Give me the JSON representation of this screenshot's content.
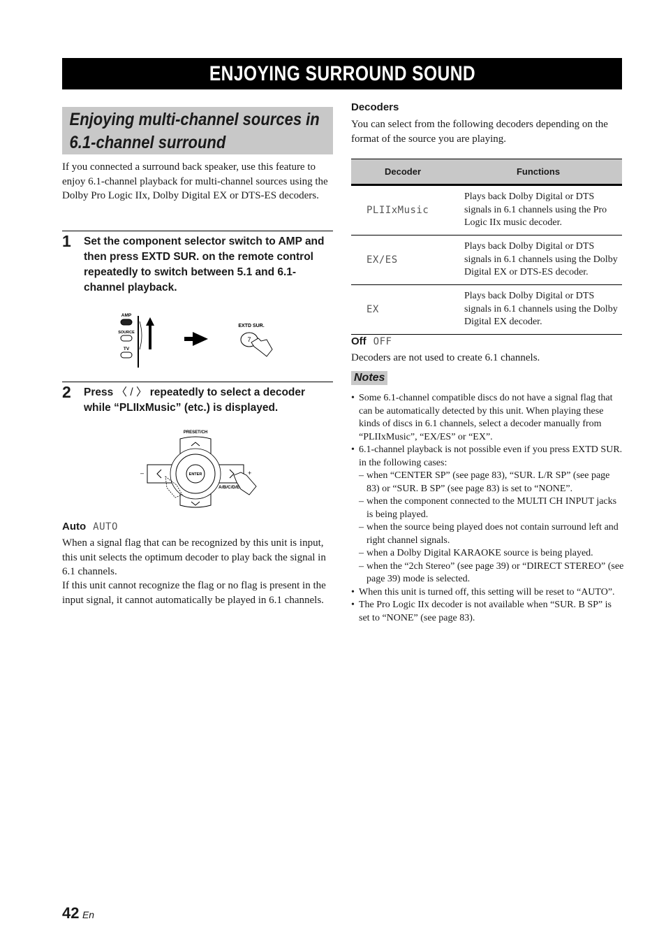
{
  "banner": {
    "title": "ENJOYING SURROUND SOUND"
  },
  "section": {
    "title_line1": "Enjoying multi-channel sources in",
    "title_line2": "6.1-channel surround",
    "intro": "If you connected a surround back speaker, use this feature to enjoy 6.1-channel playback for multi-channel sources using the Dolby Pro Logic IIx, Dolby Digital EX or DTS-ES decoders."
  },
  "steps": [
    {
      "number": "1",
      "text": "Set the component selector switch to AMP and then press EXTD SUR. on the remote control repeatedly to switch between 5.1 and 6.1-channel playback.",
      "illustration": {
        "switch_labels": [
          "AMP",
          "SOURCE",
          "TV"
        ],
        "button_label": "EXTD SUR.",
        "button_digit": "7"
      }
    },
    {
      "number": "2",
      "text_before": "Press ",
      "text_keys": "〈 / 〉",
      "text_after": " repeatedly to select a decoder while “PLIIxMusic” (etc.) is displayed.",
      "illustration": {
        "top_label": "PRESET/CH",
        "center_label": "ENTER",
        "right_label": "A/B/C/D/E",
        "minus": "–",
        "plus": "+"
      }
    }
  ],
  "auto": {
    "label": "Auto",
    "lcd": "AUTO",
    "para1": "When a signal flag that can be recognized by this unit is input, this unit selects the optimum decoder to play back the signal in 6.1 channels.",
    "para2": "If this unit cannot recognize the flag or no flag is present in the input signal, it cannot automatically be played in 6.1 channels."
  },
  "decoders": {
    "heading": "Decoders",
    "intro": "You can select from the following decoders depending on the format of the source you are playing.",
    "table": {
      "headers": [
        "Decoder",
        "Functions"
      ],
      "rows": [
        {
          "decoder": "PLIIxMusic",
          "function": "Plays back Dolby Digital or DTS signals in 6.1 channels using the Pro Logic IIx music decoder."
        },
        {
          "decoder": "EX/ES",
          "function": "Plays back Dolby Digital or DTS signals in 6.1 channels using the Dolby Digital EX or DTS-ES decoder."
        },
        {
          "decoder": "EX",
          "function": "Plays back Dolby Digital or DTS signals in 6.1 channels using the Dolby Digital EX decoder."
        }
      ]
    }
  },
  "off": {
    "label": "Off",
    "lcd": "OFF",
    "text": "Decoders are not used to create 6.1 channels."
  },
  "notes": {
    "tag": "Notes",
    "items": [
      {
        "type": "bullet",
        "text": "Some 6.1-channel compatible discs do not have a signal flag that can be automatically detected by this unit. When playing these kinds of discs in 6.1 channels, select a decoder manually from “PLIIxMusic”, “EX/ES” or “EX”."
      },
      {
        "type": "bullet",
        "text": "6.1-channel playback is not possible even if you press EXTD SUR. in the following cases:"
      },
      {
        "type": "dash",
        "text": "when “CENTER SP” (see page 83), “SUR. L/R SP” (see page 83) or “SUR. B SP” (see page 83) is set to “NONE”."
      },
      {
        "type": "dash",
        "text": "when the component connected to the MULTI CH INPUT jacks is being played."
      },
      {
        "type": "dash",
        "text": "when the source being played does not contain surround left and right channel signals."
      },
      {
        "type": "dash",
        "text": "when a Dolby Digital KARAOKE source is being played."
      },
      {
        "type": "dash",
        "text": "when the “2ch Stereo” (see page 39) or “DIRECT STEREO” (see page 39) mode is selected."
      },
      {
        "type": "bullet",
        "text": "When this unit is turned off, this setting will be reset to “AUTO”."
      },
      {
        "type": "bullet",
        "text": "The Pro Logic IIx decoder is not available when “SUR. B SP” is set to “NONE” (see page 83)."
      }
    ]
  },
  "footer": {
    "page_number": "42",
    "language": "En"
  }
}
